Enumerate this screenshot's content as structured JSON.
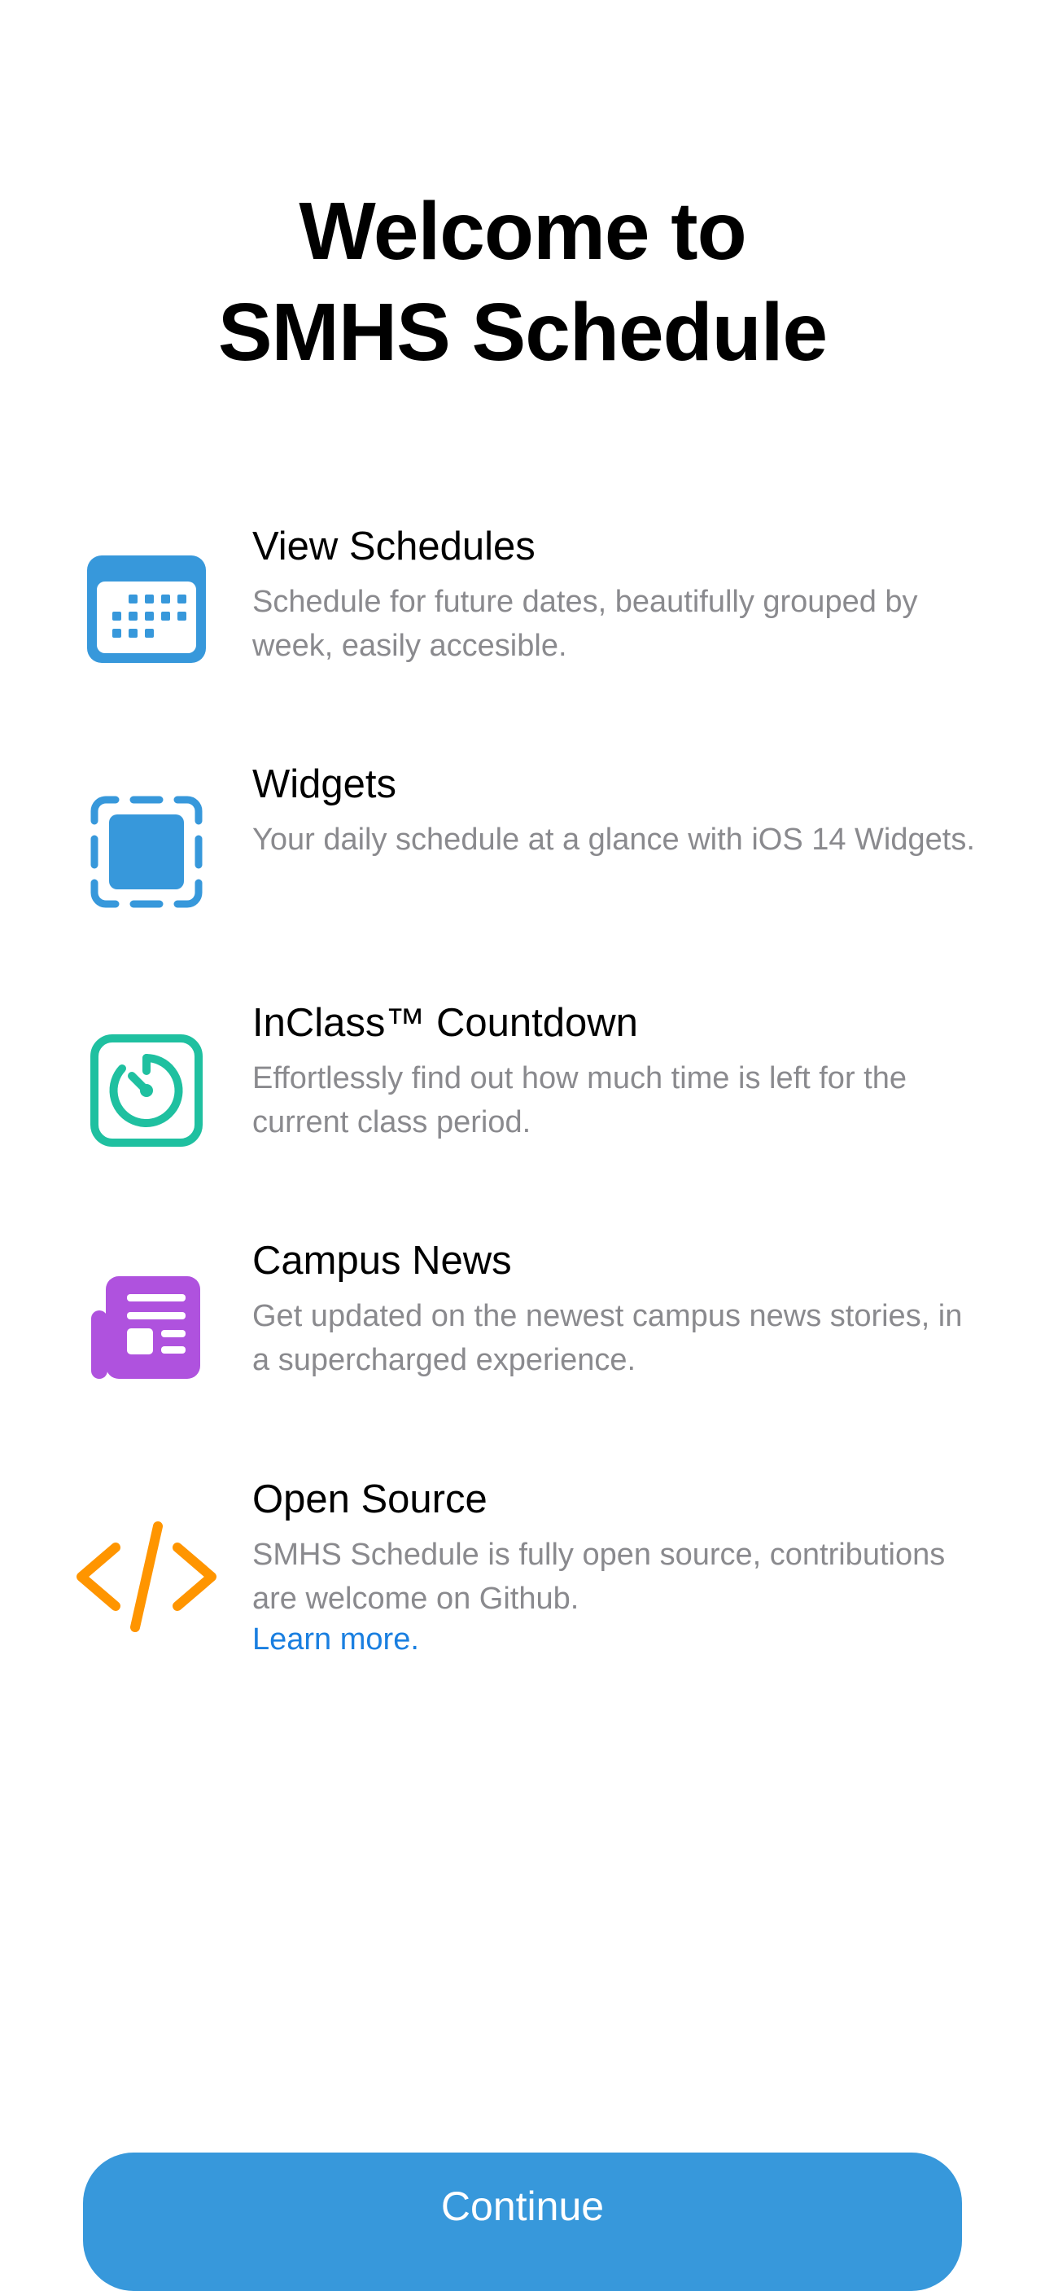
{
  "header": {
    "title_line1": "Welcome to",
    "title_line2": "SMHS Schedule"
  },
  "features": [
    {
      "title": "View Schedules",
      "description": "Schedule for future dates, beautifully grouped by week, easily accesible.",
      "icon": "calendar-icon",
      "color": "#3798db"
    },
    {
      "title": "Widgets",
      "description": "Your daily schedule at a glance with iOS 14 Widgets.",
      "icon": "widget-icon",
      "color": "#3798db"
    },
    {
      "title": "InClass™ Countdown",
      "description": "Effortlessly find out how much time is left for the current class period.",
      "icon": "timer-icon",
      "color": "#1fc0a0"
    },
    {
      "title": "Campus News",
      "description": "Get updated on the newest campus news stories, in a supercharged experience.",
      "icon": "newspaper-icon",
      "color": "#af52de"
    },
    {
      "title": "Open Source",
      "description": "SMHS Schedule is fully open source, contributions are welcome on Github.",
      "link": "Learn more.",
      "icon": "code-icon",
      "color": "#ff9500"
    }
  ],
  "continue_button": {
    "label": "Continue",
    "color": "#3798db"
  }
}
